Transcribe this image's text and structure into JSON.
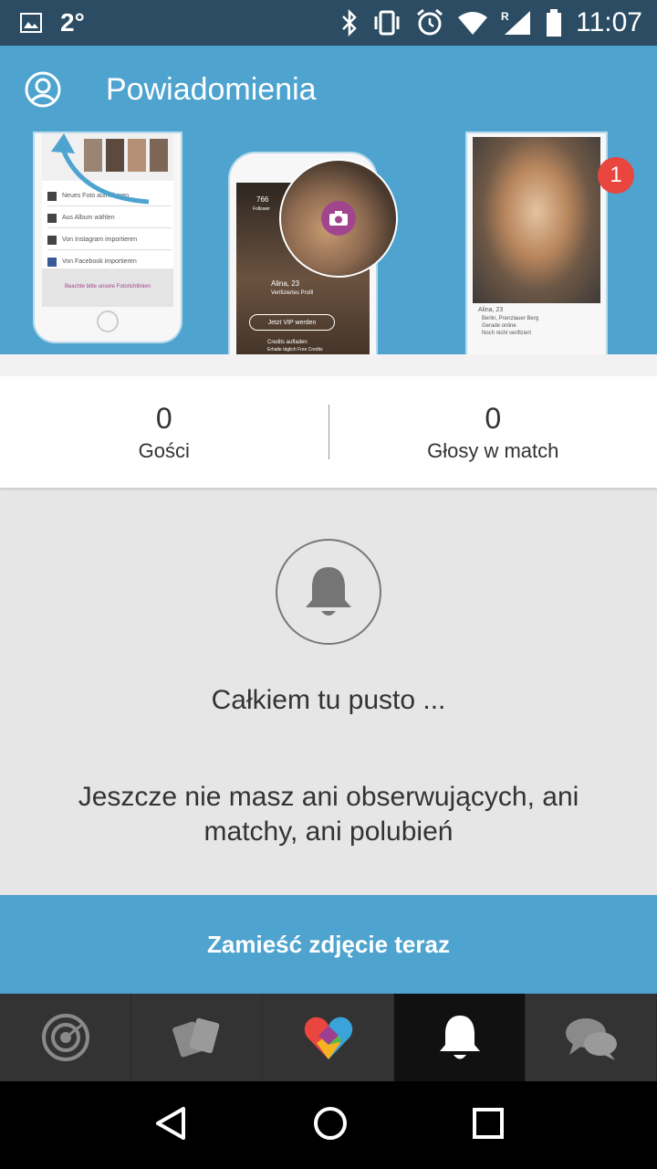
{
  "status_bar": {
    "temperature": "2°",
    "time": "11:07",
    "icons": [
      "image-icon",
      "bluetooth-icon",
      "vibrate-icon",
      "alarm-icon",
      "wifi-icon",
      "signal-roaming-icon",
      "battery-icon"
    ]
  },
  "app_bar": {
    "title": "Powiadomienia",
    "profile_icon": "profile-icon"
  },
  "banner": {
    "phone1_rows": [
      "Neues Foto aufnehmen",
      "Aus Album wählen",
      "Von Instagram importieren",
      "Von Facebook importieren"
    ],
    "phone1_footer": "Beachte bitte unsere Fotorichtlinien",
    "phone2_followers_num": "766",
    "phone2_followers_label": "Follower",
    "phone2_name": "Alina, 23",
    "phone2_verified": "Verifiziertes Profil",
    "phone2_vip_button": "Jetzt VIP werden",
    "phone2_credits_title": "Credits aufladen",
    "phone2_credits_sub": "Erhalte täglich Free Credits",
    "phone3_name": "Alina, 23",
    "phone3_lines": [
      "Berlin, Prenzlauer Berg",
      "Gerade online",
      "Noch nicht verifiziert"
    ],
    "notification_badge": "1"
  },
  "stats": [
    {
      "value": "0",
      "label": "Gości"
    },
    {
      "value": "0",
      "label": "Głosy w match"
    }
  ],
  "empty_state": {
    "title": "Całkiem tu pusto ...",
    "description": "Jeszcze nie masz ani obserwujących, ani matchy, ani polubień"
  },
  "cta": {
    "label": "Zamieść zdjęcie teraz"
  },
  "tabs": [
    {
      "icon": "radar-icon",
      "active": false
    },
    {
      "icon": "cards-icon",
      "active": false
    },
    {
      "icon": "heart-logo-icon",
      "active": false
    },
    {
      "icon": "bell-icon",
      "active": true
    },
    {
      "icon": "chat-icon",
      "active": false
    }
  ],
  "nav_bar": [
    "back-icon",
    "home-icon",
    "recents-icon"
  ],
  "colors": {
    "status_bar": "#2b4c62",
    "accent": "#4ea4cf",
    "badge": "#e8463f",
    "camera": "#a2458f",
    "tab_bar": "#333333",
    "tab_active": "#111111"
  }
}
